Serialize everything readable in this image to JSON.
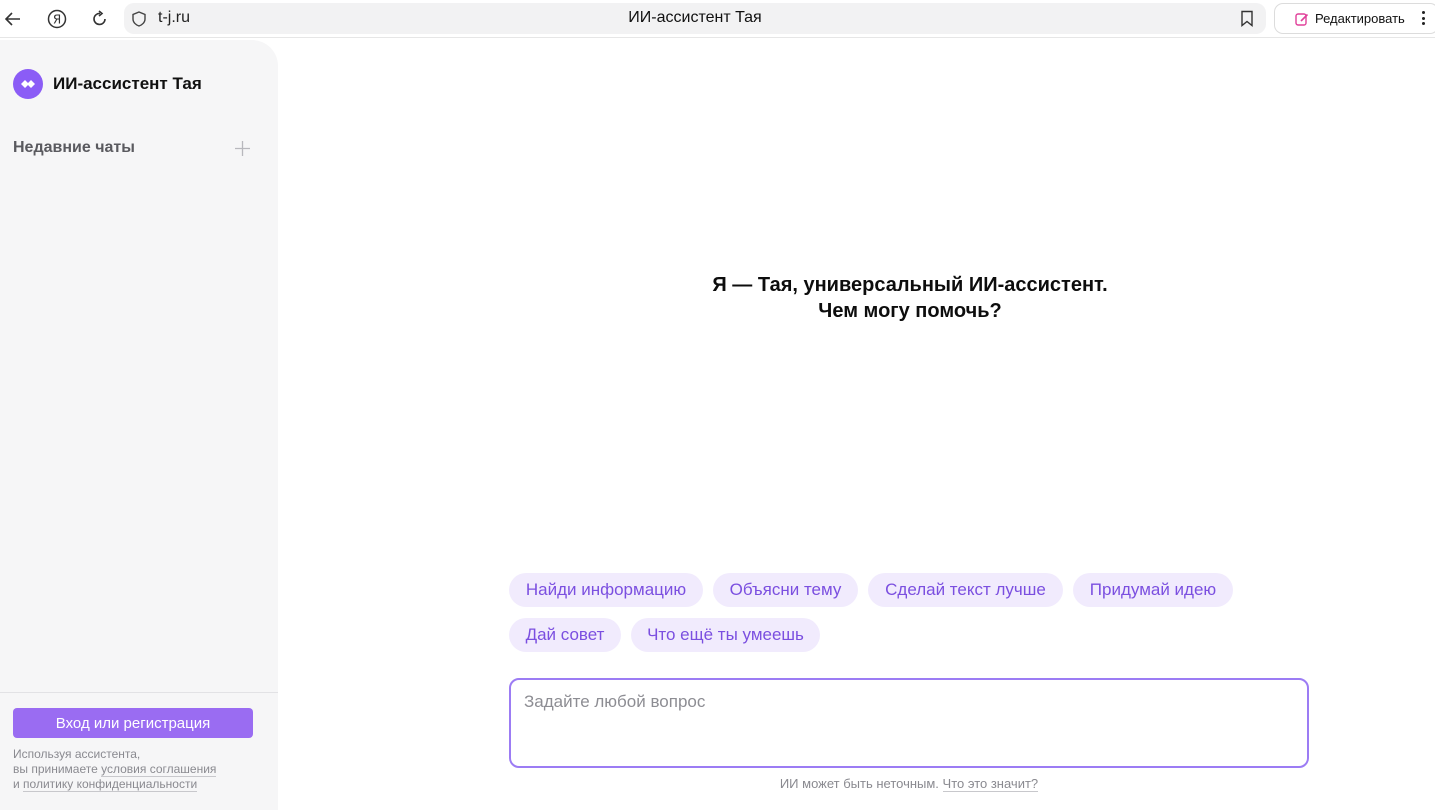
{
  "browser": {
    "url": "t-j.ru",
    "page_title": "ИИ-ассистент Тая",
    "edit_label": "Редактировать"
  },
  "sidebar": {
    "brand_name": "ИИ-ассистент Тая",
    "recent_chats_label": "Недавние чаты",
    "login_button": "Вход или регистрация",
    "legal_line1": "Используя ассистента,",
    "legal_line2_prefix": "вы принимаете ",
    "legal_terms_link": "условия соглашения",
    "legal_line3_prefix": "и ",
    "legal_privacy_link": "политику конфиденциальности"
  },
  "main": {
    "greeting_line1": "Я — Тая, универсальный ИИ-ассистент.",
    "greeting_line2": "Чем могу помочь?",
    "suggestions": [
      "Найди информацию",
      "Объясни тему",
      "Сделай текст лучше",
      "Придумай идею",
      "Дай совет",
      "Что ещё ты умеешь"
    ],
    "input_placeholder": "Задайте любой вопрос",
    "disclaimer_text": "ИИ может быть неточным. ",
    "disclaimer_link": "Что это значит?"
  },
  "colors": {
    "accent": "#9a6cf2",
    "chip_bg": "#f1ebfd",
    "chip_text": "#7b4fe0",
    "sidebar_bg": "#f6f6f7"
  }
}
